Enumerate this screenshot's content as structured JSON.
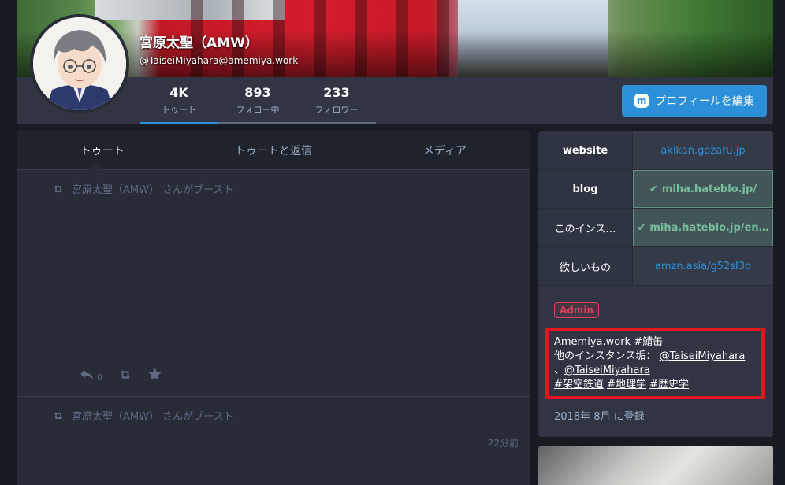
{
  "profile": {
    "display_name": "宮原太聖（AMW）",
    "account": "@TaiseiMiyahara@amemiya.work",
    "edit_button": "プロフィールを編集",
    "stats": [
      {
        "num": "4K",
        "label": "トゥート"
      },
      {
        "num": "893",
        "label": "フォロー中"
      },
      {
        "num": "233",
        "label": "フォロワー"
      }
    ]
  },
  "timeline": {
    "tabs": [
      "トゥート",
      "トゥートと返信",
      "メディア"
    ],
    "statuses": [
      {
        "prepend": "宮原太聖（AMW） さんがブースト",
        "reply_count": "0"
      },
      {
        "prepend": "宮原太聖（AMW） さんがブースト",
        "time": "22分前"
      }
    ]
  },
  "fields": [
    {
      "key": "website",
      "value": "akikan.gozaru.jp",
      "verified": false
    },
    {
      "key": "blog",
      "value": "miha.hateblo.jp/",
      "verified": true
    },
    {
      "key": "このインス…",
      "value": "miha.hateblo.jp/en…",
      "verified": true
    },
    {
      "key": "欲しいもの",
      "value": "amzn.asia/g52sI3o",
      "verified": false
    }
  ],
  "badge": "Admin",
  "bio": {
    "l1_text": "Amemiya.work ",
    "l1_tag": "#鯖缶",
    "l2_text": "他のインスタンス垢：",
    "l2_link": "@TaiseiMiyahara",
    "l3_prefix": "、",
    "l3_link": "@TaiseiMiyahara",
    "tag1": "#架空鉄道",
    "tag2": "#地理学",
    "tag3": "#歴史学"
  },
  "joined": "2018年 8月 に登録",
  "icons": {
    "boost": "boost-icon",
    "reply": "reply-icon",
    "star": "star-icon",
    "check": "check-icon",
    "mastodon": "mastodon-icon"
  },
  "colors": {
    "accent": "#2b90d9",
    "verified": "#79bd9a",
    "admin": "#df405a",
    "highlight": "#e8131f"
  }
}
